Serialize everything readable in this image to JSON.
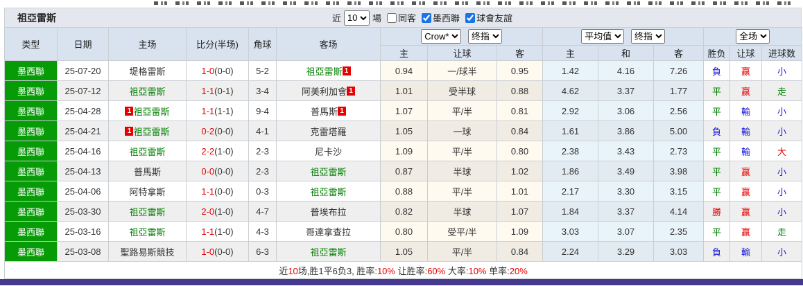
{
  "toolbar": {
    "team_title": "祖亞雷斯",
    "near_label": "近",
    "count_value": "10",
    "matches_label": "場",
    "filters": [
      {
        "label": "同客",
        "checked": false
      },
      {
        "label": "墨西聯",
        "checked": true
      },
      {
        "label": "球會友誼",
        "checked": true
      }
    ]
  },
  "header": {
    "cols": [
      "类型",
      "日期",
      "主场",
      "比分(半场)",
      "角球",
      "客场"
    ],
    "group1": {
      "bookmaker": "Crow*",
      "final": "终指"
    },
    "group2": {
      "avg": "平均值",
      "final": "终指"
    },
    "group3": {
      "scope": "全场"
    },
    "sub": [
      "主",
      "让球",
      "客",
      "主",
      "和",
      "客",
      "胜负",
      "让球",
      "进球数"
    ]
  },
  "rows": [
    {
      "league": "墨西聯",
      "date": "25-07-20",
      "home": {
        "pre": "",
        "name": "堤格雷斯",
        "cls": "",
        "post": ""
      },
      "ft": "1-0",
      "ht": "(0-0)",
      "corners": "5-2",
      "away": {
        "pre": "",
        "name": "祖亞雷斯",
        "cls": "t-green",
        "post": "1"
      },
      "o_home": "0.94",
      "o_hcap": "一/球半",
      "o_away": "0.95",
      "e_home": "1.42",
      "e_draw": "4.16",
      "e_away": "7.26",
      "r_wdl": {
        "t": "負",
        "c": "c-blue"
      },
      "r_hcap": {
        "t": "赢",
        "c": "c-red"
      },
      "r_ou": {
        "t": "小",
        "c": "c-blue"
      }
    },
    {
      "league": "墨西聯",
      "date": "25-07-12",
      "home": {
        "pre": "",
        "name": "祖亞雷斯",
        "cls": "t-green",
        "post": ""
      },
      "ft": "1-1",
      "ht": "(0-1)",
      "corners": "3-4",
      "away": {
        "pre": "",
        "name": "阿美利加會",
        "cls": "",
        "post": "1"
      },
      "o_home": "1.01",
      "o_hcap": "受半球",
      "o_away": "0.88",
      "e_home": "4.62",
      "e_draw": "3.37",
      "e_away": "1.77",
      "r_wdl": {
        "t": "平",
        "c": "c-green"
      },
      "r_hcap": {
        "t": "赢",
        "c": "c-red"
      },
      "r_ou": {
        "t": "走",
        "c": "c-green"
      }
    },
    {
      "league": "墨西聯",
      "date": "25-04-28",
      "home": {
        "pre": "1",
        "name": "祖亞雷斯",
        "cls": "t-green",
        "post": ""
      },
      "ft": "1-1",
      "ht": "(1-1)",
      "corners": "9-4",
      "away": {
        "pre": "",
        "name": "普馬斯",
        "cls": "",
        "post": "1"
      },
      "o_home": "1.07",
      "o_hcap": "平/半",
      "o_away": "0.81",
      "e_home": "2.92",
      "e_draw": "3.06",
      "e_away": "2.56",
      "r_wdl": {
        "t": "平",
        "c": "c-green"
      },
      "r_hcap": {
        "t": "輸",
        "c": "c-blue"
      },
      "r_ou": {
        "t": "小",
        "c": "c-blue"
      }
    },
    {
      "league": "墨西聯",
      "date": "25-04-21",
      "home": {
        "pre": "1",
        "name": "祖亞雷斯",
        "cls": "t-green",
        "post": ""
      },
      "ft": "0-2",
      "ht": "(0-0)",
      "corners": "4-1",
      "away": {
        "pre": "",
        "name": "克雷塔羅",
        "cls": "",
        "post": ""
      },
      "o_home": "1.05",
      "o_hcap": "一球",
      "o_away": "0.84",
      "e_home": "1.61",
      "e_draw": "3.86",
      "e_away": "5.00",
      "r_wdl": {
        "t": "負",
        "c": "c-blue"
      },
      "r_hcap": {
        "t": "輸",
        "c": "c-blue"
      },
      "r_ou": {
        "t": "小",
        "c": "c-blue"
      }
    },
    {
      "league": "墨西聯",
      "date": "25-04-16",
      "home": {
        "pre": "",
        "name": "祖亞雷斯",
        "cls": "t-green",
        "post": ""
      },
      "ft": "2-2",
      "ht": "(1-0)",
      "corners": "2-3",
      "away": {
        "pre": "",
        "name": "尼卡沙",
        "cls": "",
        "post": ""
      },
      "o_home": "1.09",
      "o_hcap": "平/半",
      "o_away": "0.80",
      "e_home": "2.38",
      "e_draw": "3.43",
      "e_away": "2.73",
      "r_wdl": {
        "t": "平",
        "c": "c-green"
      },
      "r_hcap": {
        "t": "輸",
        "c": "c-blue"
      },
      "r_ou": {
        "t": "大",
        "c": "c-red"
      }
    },
    {
      "league": "墨西聯",
      "date": "25-04-13",
      "home": {
        "pre": "",
        "name": "普馬斯",
        "cls": "",
        "post": ""
      },
      "ft": "0-0",
      "ht": "(0-0)",
      "corners": "2-3",
      "away": {
        "pre": "",
        "name": "祖亞雷斯",
        "cls": "t-green",
        "post": ""
      },
      "o_home": "0.87",
      "o_hcap": "半球",
      "o_away": "1.02",
      "e_home": "1.86",
      "e_draw": "3.49",
      "e_away": "3.98",
      "r_wdl": {
        "t": "平",
        "c": "c-green"
      },
      "r_hcap": {
        "t": "赢",
        "c": "c-red"
      },
      "r_ou": {
        "t": "小",
        "c": "c-blue"
      }
    },
    {
      "league": "墨西聯",
      "date": "25-04-06",
      "home": {
        "pre": "",
        "name": "阿特拿斯",
        "cls": "",
        "post": ""
      },
      "ft": "1-1",
      "ht": "(0-0)",
      "corners": "0-3",
      "away": {
        "pre": "",
        "name": "祖亞雷斯",
        "cls": "t-green",
        "post": ""
      },
      "o_home": "0.88",
      "o_hcap": "平/半",
      "o_away": "1.01",
      "e_home": "2.17",
      "e_draw": "3.30",
      "e_away": "3.15",
      "r_wdl": {
        "t": "平",
        "c": "c-green"
      },
      "r_hcap": {
        "t": "赢",
        "c": "c-red"
      },
      "r_ou": {
        "t": "小",
        "c": "c-blue"
      }
    },
    {
      "league": "墨西聯",
      "date": "25-03-30",
      "home": {
        "pre": "",
        "name": "祖亞雷斯",
        "cls": "t-green",
        "post": ""
      },
      "ft": "2-0",
      "ht": "(1-0)",
      "corners": "4-7",
      "away": {
        "pre": "",
        "name": "普埃布拉",
        "cls": "",
        "post": ""
      },
      "o_home": "0.82",
      "o_hcap": "半球",
      "o_away": "1.07",
      "e_home": "1.84",
      "e_draw": "3.37",
      "e_away": "4.14",
      "r_wdl": {
        "t": "勝",
        "c": "c-red"
      },
      "r_hcap": {
        "t": "赢",
        "c": "c-red"
      },
      "r_ou": {
        "t": "小",
        "c": "c-blue"
      }
    },
    {
      "league": "墨西聯",
      "date": "25-03-16",
      "home": {
        "pre": "",
        "name": "祖亞雷斯",
        "cls": "t-green",
        "post": ""
      },
      "ft": "1-1",
      "ht": "(1-0)",
      "corners": "4-3",
      "away": {
        "pre": "",
        "name": "哥達拿查拉",
        "cls": "",
        "post": ""
      },
      "o_home": "0.80",
      "o_hcap": "受平/半",
      "o_away": "1.09",
      "e_home": "3.03",
      "e_draw": "3.07",
      "e_away": "2.35",
      "r_wdl": {
        "t": "平",
        "c": "c-green"
      },
      "r_hcap": {
        "t": "赢",
        "c": "c-red"
      },
      "r_ou": {
        "t": "走",
        "c": "c-green"
      }
    },
    {
      "league": "墨西聯",
      "date": "25-03-08",
      "home": {
        "pre": "",
        "name": "聖路易斯競技",
        "cls": "",
        "post": ""
      },
      "ft": "1-0",
      "ht": "(0-0)",
      "corners": "6-3",
      "away": {
        "pre": "",
        "name": "祖亞雷斯",
        "cls": "t-green",
        "post": ""
      },
      "o_home": "1.05",
      "o_hcap": "平/半",
      "o_away": "0.84",
      "e_home": "2.24",
      "e_draw": "3.29",
      "e_away": "3.03",
      "r_wdl": {
        "t": "負",
        "c": "c-blue"
      },
      "r_hcap": {
        "t": "輸",
        "c": "c-blue"
      },
      "r_ou": {
        "t": "小",
        "c": "c-blue"
      }
    }
  ],
  "summary": {
    "parts": [
      {
        "t": "近",
        "c": ""
      },
      {
        "t": "10",
        "c": "sum-r"
      },
      {
        "t": "场,胜1平6负3, 胜率:",
        "c": ""
      },
      {
        "t": "10%",
        "c": "sum-r"
      },
      {
        "t": " 让胜率:",
        "c": ""
      },
      {
        "t": "60%",
        "c": "sum-r"
      },
      {
        "t": " 大率:",
        "c": ""
      },
      {
        "t": "10%",
        "c": "sum-r"
      },
      {
        "t": " 单率:",
        "c": ""
      },
      {
        "t": "20%",
        "c": "sum-r"
      }
    ]
  },
  "colors": {
    "league-green": "#089b08",
    "team-green": "#008000",
    "score-red": "#e60000",
    "res-red": "#e60000",
    "res-blue": "#1616d9",
    "res-green": "#008000",
    "footer-purple": "#453a8f",
    "header-bg": "#d9e3f0",
    "titlebar-bg": "#e4e8ee"
  }
}
